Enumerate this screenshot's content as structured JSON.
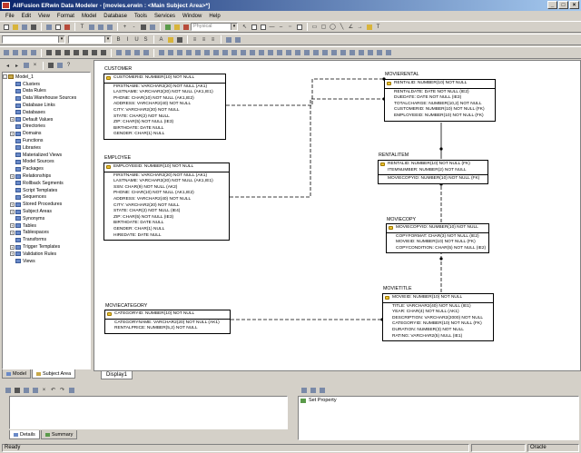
{
  "window": {
    "title": "AllFusion ERwin Data Modeler - [movies.erwin : <Main Subject Area>*]"
  },
  "menu": [
    "File",
    "Edit",
    "View",
    "Format",
    "Model",
    "Database",
    "Tools",
    "Services",
    "Window",
    "Help"
  ],
  "toolbar": {
    "view_combo": "Physical"
  },
  "model_tree": {
    "root": "Model_1",
    "items": [
      {
        "label": "Clusters",
        "expandable": false
      },
      {
        "label": "Data Rules",
        "expandable": false
      },
      {
        "label": "Data Warehouse Sources",
        "expandable": false
      },
      {
        "label": "Database Links",
        "expandable": false
      },
      {
        "label": "Databases",
        "expandable": false
      },
      {
        "label": "Default Values",
        "expandable": true
      },
      {
        "label": "Directories",
        "expandable": false
      },
      {
        "label": "Domains",
        "expandable": true
      },
      {
        "label": "Functions",
        "expandable": false
      },
      {
        "label": "Libraries",
        "expandable": false
      },
      {
        "label": "Materialized Views",
        "expandable": false
      },
      {
        "label": "Model Sources",
        "expandable": false
      },
      {
        "label": "Packages",
        "expandable": false
      },
      {
        "label": "Relationships",
        "expandable": true
      },
      {
        "label": "Rollback Segments",
        "expandable": false
      },
      {
        "label": "Script Templates",
        "expandable": false
      },
      {
        "label": "Sequences",
        "expandable": false
      },
      {
        "label": "Stored Procedures",
        "expandable": true
      },
      {
        "label": "Subject Areas",
        "expandable": true
      },
      {
        "label": "Synonyms",
        "expandable": false
      },
      {
        "label": "Tables",
        "expandable": true
      },
      {
        "label": "Tablespaces",
        "expandable": true
      },
      {
        "label": "Transforms",
        "expandable": false
      },
      {
        "label": "Trigger Templates",
        "expandable": true
      },
      {
        "label": "Validation Rules",
        "expandable": true
      },
      {
        "label": "Views",
        "expandable": false
      }
    ],
    "tabs": [
      "Model",
      "Subject Area"
    ]
  },
  "diagram": {
    "tab": "Display1",
    "entities": {
      "customer": {
        "name": "CUSTOMER",
        "pk": [
          "CUSTOMERID: NUMBER(10) NOT NULL"
        ],
        "attrs": [
          "FIRSTNAME: VARCHAR2(20) NOT NULL (AK1)",
          "LASTNAME: VARCHAR2(20) NOT NULL (AK1,IE1)",
          "PHONE: CHAR(10) NOT NULL (AK1,IE2)",
          "ADDRESS: VARCHAR2(40) NOT NULL",
          "CITY: VARCHAR2(20) NOT NULL",
          "STATE: CHAR(2) NOT NULL",
          "ZIP: CHAR(5) NOT NULL (IE3)",
          "BIRTHDATE: DATE NULL",
          "GENDER: CHAR(1) NULL"
        ]
      },
      "movierental": {
        "name": "MOVIERENTAL",
        "pk": [
          "RENTALID: NUMBER(10) NOT NULL"
        ],
        "attrs": [
          "RENTALDATE: DATE NOT NULL (IE2)",
          "DUEDATE: DATE NOT NULL (IE3)",
          "TOTALCHARGE: NUMBER(10,2) NOT NULL",
          "CUSTOMERID: NUMBER(10) NOT NULL (FK)",
          "EMPLOYEEID: NUMBER(10) NOT NULL (FK)"
        ]
      },
      "employee": {
        "name": "EMPLOYEE",
        "pk": [
          "EMPLOYEEID: NUMBER(10) NOT NULL"
        ],
        "attrs": [
          "FIRSTNAME: VARCHAR2(20) NOT NULL (AK1)",
          "LASTNAME: VARCHAR2(20) NOT NULL (AK1,IE1)",
          "SSN: CHAR(9) NOT NULL (AK2)",
          "PHONE: CHAR(10) NOT NULL (AK1,IE2)",
          "ADDRESS: VARCHAR2(40) NOT NULL",
          "CITY: VARCHAR2(20) NOT NULL",
          "STATE: CHAR(2) NOT NULL (IE4)",
          "ZIP: CHAR(5) NOT NULL (IE3)",
          "BIRTHDATE: DATE NULL",
          "GENDER: CHAR(1) NULL",
          "HIREDATE: DATE NULL"
        ]
      },
      "rentalitem": {
        "name": "RENTALITEM",
        "pk": [
          "RENTALID: NUMBER(10) NOT NULL (FK)",
          "ITEMNUMBER: NUMBER(2) NOT NULL"
        ],
        "attrs": [
          "MOVIECOPYID: NUMBER(10) NOT NULL (FK)"
        ]
      },
      "moviecopy": {
        "name": "MOVIECOPY",
        "pk": [
          "MOVIECOPYID: NUMBER(10) NOT NULL"
        ],
        "attrs": [
          "COPYFORMAT: CHAR(3) NOT NULL (IE2)",
          "MOVIEID: NUMBER(10) NOT NULL (FK)",
          "COPYCONDITION: CHAR(5) NOT NULL (IE2)"
        ]
      },
      "moviecategory": {
        "name": "MOVIECATEGORY",
        "pk": [
          "CATEGORYID: NUMBER(10) NOT NULL"
        ],
        "attrs": [
          "CATEGORYNAME: VARCHAR2(20) NOT NULL (AK1)",
          "RENTALPRICE: NUMBER(5,2) NOT NULL"
        ]
      },
      "movietitle": {
        "name": "MOVIETITLE",
        "pk": [
          "MOVIEID: NUMBER(10) NOT NULL"
        ],
        "attrs": [
          "TITLE: VARCHAR2(40) NOT NULL (IE1)",
          "YEAR: CHAR(4) NOT NULL (AK1)",
          "DESCRIPTION: VARCHAR2(2000) NOT NULL",
          "CATEGORYID: NUMBER(10) NOT NULL (FK)",
          "DURATION: NUMBER(3) NOT NULL",
          "RATING: VARCHAR2(5) NULL (IE1)"
        ]
      }
    }
  },
  "bottom_left": {
    "tabs": [
      "Details",
      "Summary"
    ]
  },
  "bottom_right": {
    "items": [
      "Set Property"
    ]
  },
  "status": {
    "left": "Ready",
    "right": "Oracle"
  }
}
